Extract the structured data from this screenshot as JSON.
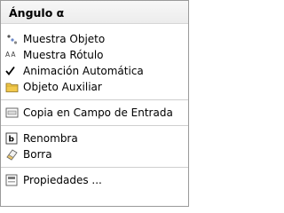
{
  "menu": {
    "title": "Ángulo α",
    "items": [
      {
        "label": "Muestra Objeto",
        "icon": "show-object-icon"
      },
      {
        "label": "Muestra Rótulo",
        "icon": "show-label-icon",
        "icon_text": "AA"
      },
      {
        "label": "Animación Automática",
        "icon": "checkmark-icon",
        "checked": true
      },
      {
        "label": "Objeto Auxiliar",
        "icon": "folder-icon"
      },
      {
        "label": "Copia en Campo de Entrada",
        "icon": "copy-to-input-icon"
      },
      {
        "label": "Renombra",
        "icon": "rename-icon"
      },
      {
        "label": "Borra",
        "icon": "eraser-icon"
      },
      {
        "label": "Propiedades ...",
        "icon": "properties-icon"
      }
    ]
  },
  "colors": {
    "folder": "#f2c94c",
    "border": "#9a9a9a",
    "separator": "#cfcfcf"
  }
}
